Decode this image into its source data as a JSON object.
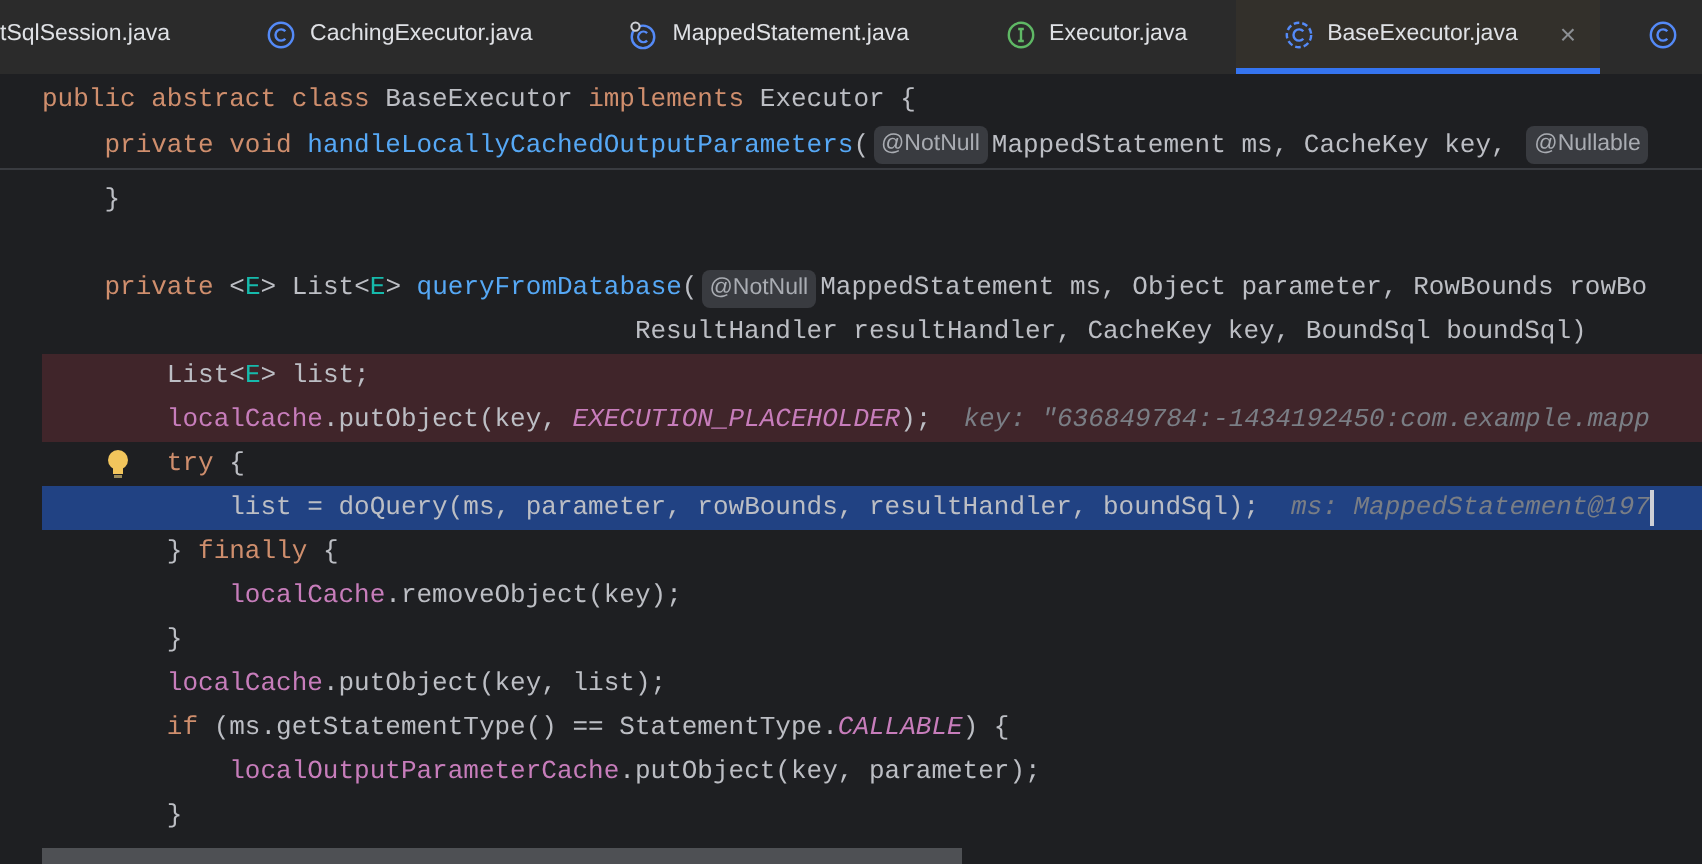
{
  "tabs": [
    {
      "label": "tSqlSession.java",
      "kind": "none",
      "selected": false,
      "closable": false
    },
    {
      "label": "CachingExecutor.java",
      "kind": "class",
      "selected": false,
      "closable": false
    },
    {
      "label": "MappedStatement.java",
      "kind": "class-final",
      "selected": false,
      "closable": false
    },
    {
      "label": "Executor.java",
      "kind": "interface",
      "selected": false,
      "closable": false
    },
    {
      "label": "BaseExecutor.java",
      "kind": "abstract",
      "selected": true,
      "closable": true,
      "close": "×"
    },
    {
      "kind": "class",
      "selected": false,
      "closable": false
    }
  ],
  "sticky_lines": [
    {
      "tokens": [
        {
          "kind": "kw",
          "text": "public abstract class "
        },
        {
          "kind": "plain",
          "text": "BaseExecutor "
        },
        {
          "kind": "kw",
          "text": "implements "
        },
        {
          "kind": "plain",
          "text": "Executor {"
        }
      ]
    },
    {
      "tokens": [
        {
          "kind": "kw",
          "text": "    private void "
        },
        {
          "kind": "method",
          "text": "handleLocallyCachedOutputParameters"
        },
        {
          "kind": "plain",
          "text": "("
        },
        {
          "kind": "chip",
          "text": "@NotNull"
        },
        {
          "kind": "plain",
          "text": "MappedStatement ms, CacheKey key, "
        },
        {
          "kind": "chip",
          "text": "@Nullable"
        }
      ]
    }
  ],
  "lines": [
    {
      "kind": "normal",
      "bulb": false,
      "caret": false,
      "tokens": [
        {
          "kind": "plain",
          "text": "    }"
        }
      ]
    },
    {
      "kind": "normal",
      "bulb": false,
      "caret": false
    },
    {
      "kind": "normal",
      "bulb": false,
      "caret": false,
      "tokens": [
        {
          "kind": "kw",
          "text": "    private "
        },
        {
          "kind": "plain",
          "text": "<"
        },
        {
          "kind": "tparam",
          "text": "E"
        },
        {
          "kind": "plain",
          "text": "> List<"
        },
        {
          "kind": "tparam",
          "text": "E"
        },
        {
          "kind": "plain",
          "text": "> "
        },
        {
          "kind": "method",
          "text": "queryFromDatabase"
        },
        {
          "kind": "plain",
          "text": "("
        },
        {
          "kind": "chip",
          "text": "@NotNull"
        },
        {
          "kind": "plain",
          "text": "MappedStatement ms, Object parameter, RowBounds rowBo"
        }
      ]
    },
    {
      "kind": "normal",
      "bulb": false,
      "caret": false,
      "tokens": [
        {
          "kind": "plain",
          "text": "                                      ResultHandler resultHandler, CacheKey key, BoundSql boundSql)"
        }
      ]
    },
    {
      "kind": "breakpoint",
      "bulb": false,
      "caret": false,
      "tokens": [
        {
          "kind": "plain",
          "text": "        List<"
        },
        {
          "kind": "tparam",
          "text": "E"
        },
        {
          "kind": "plain",
          "text": "> list;"
        }
      ]
    },
    {
      "kind": "breakpoint",
      "bulb": false,
      "caret": false,
      "tokens": [
        {
          "kind": "field",
          "text": "        localCache"
        },
        {
          "kind": "plain",
          "text": ".putObject(key, "
        },
        {
          "kind": "const",
          "text": "EXECUTION_PLACEHOLDER"
        },
        {
          "kind": "plain",
          "text": ");"
        },
        {
          "kind": "hint",
          "text": "key: \"636849784:-1434192450:com.example.mapp"
        }
      ]
    },
    {
      "kind": "normal",
      "bulb": true,
      "caret": false,
      "tokens": [
        {
          "kind": "kw",
          "text": "        try "
        },
        {
          "kind": "plain",
          "text": "{"
        }
      ]
    },
    {
      "kind": "current",
      "bulb": false,
      "caret": true,
      "tokens": [
        {
          "kind": "plain",
          "text": "            list = doQuery(ms, parameter, rowBounds, resultHandler, boundSql);"
        },
        {
          "kind": "hint",
          "text": "ms: MappedStatement@197"
        }
      ]
    },
    {
      "kind": "normal",
      "bulb": false,
      "caret": false,
      "tokens": [
        {
          "kind": "plain",
          "text": "        } "
        },
        {
          "kind": "kw",
          "text": "finally "
        },
        {
          "kind": "plain",
          "text": "{"
        }
      ]
    },
    {
      "kind": "normal",
      "bulb": false,
      "caret": false,
      "tokens": [
        {
          "kind": "field",
          "text": "            localCache"
        },
        {
          "kind": "plain",
          "text": ".removeObject(key);"
        }
      ]
    },
    {
      "kind": "normal",
      "bulb": false,
      "caret": false,
      "tokens": [
        {
          "kind": "plain",
          "text": "        }"
        }
      ]
    },
    {
      "kind": "normal",
      "bulb": false,
      "caret": false,
      "tokens": [
        {
          "kind": "field",
          "text": "        localCache"
        },
        {
          "kind": "plain",
          "text": ".putObject(key, list);"
        }
      ]
    },
    {
      "kind": "normal",
      "bulb": false,
      "caret": false,
      "tokens": [
        {
          "kind": "kw",
          "text": "        if "
        },
        {
          "kind": "plain",
          "text": "(ms.getStatementType() == StatementType."
        },
        {
          "kind": "const",
          "text": "CALLABLE"
        },
        {
          "kind": "plain",
          "text": ") {"
        }
      ]
    },
    {
      "kind": "normal",
      "bulb": false,
      "caret": false,
      "tokens": [
        {
          "kind": "field",
          "text": "            localOutputParameterCache"
        },
        {
          "kind": "plain",
          "text": ".putObject(key, parameter);"
        }
      ]
    },
    {
      "kind": "normal",
      "bulb": false,
      "caret": false,
      "tokens": [
        {
          "kind": "plain",
          "text": "        }"
        }
      ]
    }
  ]
}
